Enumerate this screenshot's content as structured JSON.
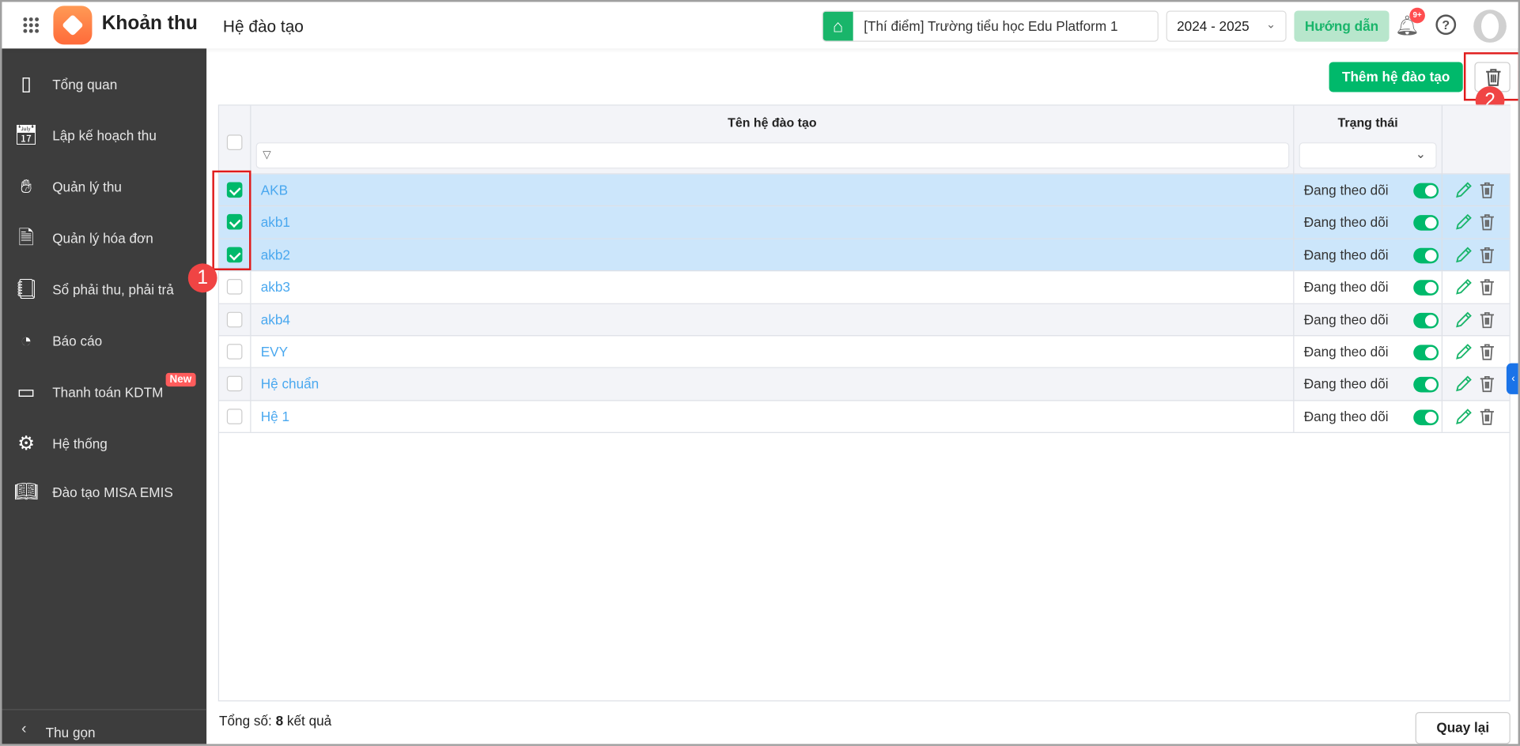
{
  "header": {
    "app_name": "Khoản thu",
    "page_title": "Hệ đào tạo",
    "school": "[Thí điểm] Trường tiểu học Edu Platform 1",
    "year": "2024 - 2025",
    "guide_label": "Hướng dẫn",
    "notif_count": "9+"
  },
  "sidebar": {
    "items": [
      {
        "label": "Tổng quan",
        "icon": "chart-bars-icon"
      },
      {
        "label": "Lập kế hoạch thu",
        "icon": "calendar-money-icon"
      },
      {
        "label": "Quản lý thu",
        "icon": "hand-coin-icon"
      },
      {
        "label": "Quản lý hóa đơn",
        "icon": "invoice-icon"
      },
      {
        "label": "Sổ phải thu, phải trả",
        "icon": "ledger-icon"
      },
      {
        "label": "Báo cáo",
        "icon": "pie-chart-icon"
      },
      {
        "label": "Thanh toán KDTM",
        "icon": "card-check-icon",
        "badge": "New"
      },
      {
        "label": "Hệ thống",
        "icon": "gear-icon"
      },
      {
        "label": "Đào tạo MISA EMIS",
        "icon": "book-icon"
      }
    ],
    "collapse_label": "Thu gọn"
  },
  "toolbar": {
    "add_label": "Thêm hệ đào tạo",
    "annotation_1": "1",
    "annotation_2": "2"
  },
  "table": {
    "columns": {
      "name": "Tên hệ đào tạo",
      "status": "Trạng thái"
    },
    "rows": [
      {
        "name": "AKB",
        "status": "Đang theo dõi",
        "checked": true,
        "active": true
      },
      {
        "name": "akb1",
        "status": "Đang theo dõi",
        "checked": true,
        "active": true
      },
      {
        "name": "akb2",
        "status": "Đang theo dõi",
        "checked": true,
        "active": true
      },
      {
        "name": "akb3",
        "status": "Đang theo dõi",
        "checked": false,
        "active": true
      },
      {
        "name": "akb4",
        "status": "Đang theo dõi",
        "checked": false,
        "active": true
      },
      {
        "name": "EVY",
        "status": "Đang theo dõi",
        "checked": false,
        "active": true
      },
      {
        "name": "Hệ chuẩn",
        "status": "Đang theo dõi",
        "checked": false,
        "active": true
      },
      {
        "name": "Hệ 1",
        "status": "Đang theo dõi",
        "checked": false,
        "active": true
      }
    ]
  },
  "footer": {
    "total_prefix": "Tổng số: ",
    "total_count": "8",
    "total_suffix": " kết quả",
    "back_label": "Quay lại"
  },
  "colors": {
    "primary": "#00b96b",
    "link": "#4aa8ef",
    "selected_row": "#cce6fb",
    "sidebar": "#3d3d3d",
    "annotation": "#e01b1b"
  }
}
